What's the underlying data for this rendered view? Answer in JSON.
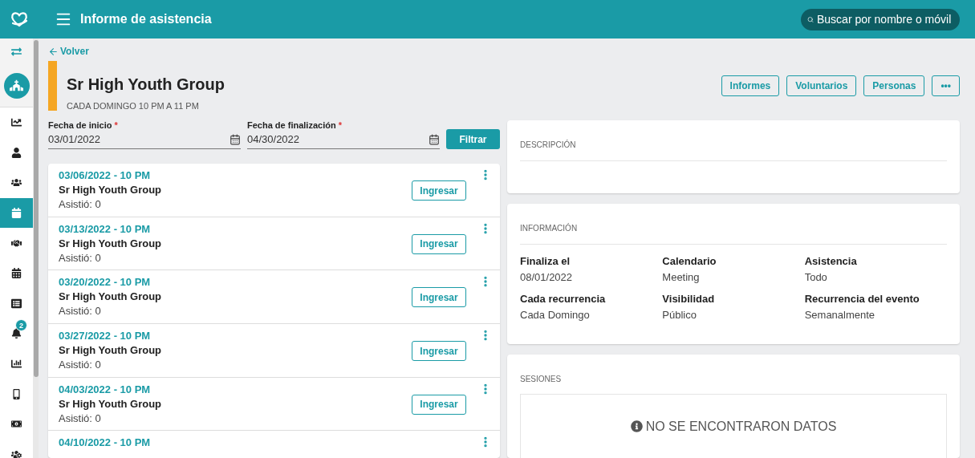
{
  "header": {
    "title": "Informe de asistencia",
    "search": {
      "placeholder": "Buscar por nombre o móvil"
    }
  },
  "sidebar": {
    "items": [
      {
        "kind": "toggle",
        "selected": false
      },
      {
        "kind": "avatar",
        "selected": false
      },
      {
        "kind": "nav",
        "selected": false
      },
      {
        "kind": "nav",
        "selected": false
      },
      {
        "kind": "nav",
        "selected": false
      },
      {
        "kind": "nav",
        "selected": true
      },
      {
        "kind": "nav",
        "selected": false
      },
      {
        "kind": "nav",
        "selected": false
      },
      {
        "kind": "nav",
        "selected": false
      },
      {
        "kind": "nav",
        "selected": false,
        "badge": "2"
      },
      {
        "kind": "nav",
        "selected": false
      },
      {
        "kind": "nav",
        "selected": false
      },
      {
        "kind": "nav",
        "selected": false
      },
      {
        "kind": "nav",
        "selected": false
      }
    ]
  },
  "back": "Volver",
  "event": {
    "title": "Sr High Youth Group",
    "schedule": "CADA DOMINGO 10 PM A 11 PM",
    "color": "#f5a623"
  },
  "actions": [
    "Informes",
    "Voluntarios",
    "Personas",
    "•••"
  ],
  "filters": {
    "start": {
      "label": "Fecha de inicio",
      "required": "*",
      "value": "03/01/2022"
    },
    "end": {
      "label": "Fecha de finalización",
      "required": "*",
      "value": "04/30/2022"
    },
    "button": "Filtrar"
  },
  "sessions": [
    {
      "date": "03/06/2022 - 10 PM",
      "name": "Sr High Youth Group",
      "attended": "Asistió: 0",
      "button": "Ingresar"
    },
    {
      "date": "03/13/2022 - 10 PM",
      "name": "Sr High Youth Group",
      "attended": "Asistió: 0",
      "button": "Ingresar"
    },
    {
      "date": "03/20/2022 - 10 PM",
      "name": "Sr High Youth Group",
      "attended": "Asistió: 0",
      "button": "Ingresar"
    },
    {
      "date": "03/27/2022 - 10 PM",
      "name": "Sr High Youth Group",
      "attended": "Asistió: 0",
      "button": "Ingresar"
    },
    {
      "date": "04/03/2022 - 10 PM",
      "name": "Sr High Youth Group",
      "attended": "Asistió: 0",
      "button": "Ingresar"
    },
    {
      "date": "04/10/2022 - 10 PM"
    }
  ],
  "description": {
    "heading": "DESCRIPCIÓN"
  },
  "information": {
    "heading": "INFORMACIÓN",
    "fields": [
      {
        "label": "Finaliza el",
        "value": "08/01/2022"
      },
      {
        "label": "Calendario",
        "value": "Meeting"
      },
      {
        "label": "Asistencia",
        "value": "Todo"
      },
      {
        "label": "Cada recurrencia",
        "value": "Cada Domingo"
      },
      {
        "label": "Visibilidad",
        "value": "Público"
      },
      {
        "label": "Recurrencia del evento",
        "value": "Semanalmente"
      }
    ]
  },
  "session_list": {
    "heading": "SESIONES",
    "empty": "NO SE ENCONTRARON DATOS"
  }
}
